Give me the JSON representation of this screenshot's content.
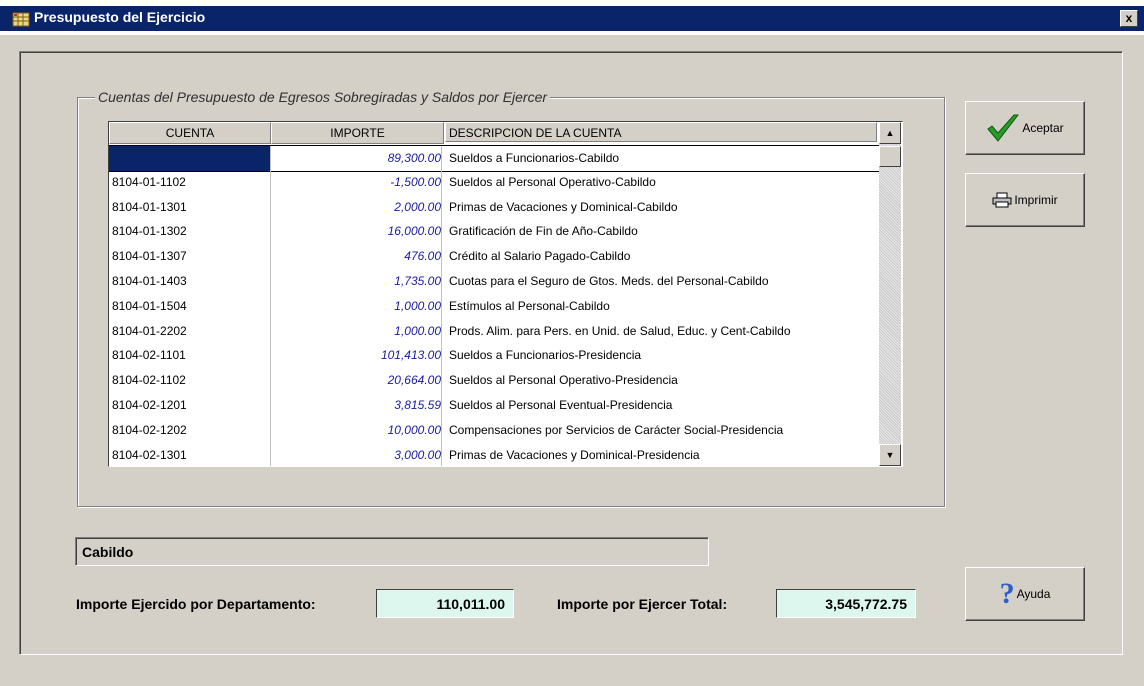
{
  "window": {
    "title": "Presupuesto del Ejercicio",
    "close_label": "x"
  },
  "group": {
    "label": "Cuentas del Presupuesto de Egresos Sobregiradas y Saldos por Ejercer"
  },
  "grid": {
    "columns": [
      "CUENTA",
      "IMPORTE",
      "DESCRIPCION DE LA CUENTA"
    ],
    "rows": [
      {
        "cuenta": "",
        "importe": "89,300.00",
        "descripcion": "Sueldos a Funcionarios-Cabildo"
      },
      {
        "cuenta": "8104-01-1102",
        "importe": "-1,500.00",
        "descripcion": "Sueldos al Personal Operativo-Cabildo"
      },
      {
        "cuenta": "8104-01-1301",
        "importe": "2,000.00",
        "descripcion": "Primas de Vacaciones y Dominical-Cabildo"
      },
      {
        "cuenta": "8104-01-1302",
        "importe": "16,000.00",
        "descripcion": "Gratificación de Fin de Año-Cabildo"
      },
      {
        "cuenta": "8104-01-1307",
        "importe": "476.00",
        "descripcion": "Crédito al Salario Pagado-Cabildo"
      },
      {
        "cuenta": "8104-01-1403",
        "importe": "1,735.00",
        "descripcion": "Cuotas para el Seguro de Gtos. Meds. del Personal-Cabildo"
      },
      {
        "cuenta": "8104-01-1504",
        "importe": "1,000.00",
        "descripcion": "Estímulos al Personal-Cabildo"
      },
      {
        "cuenta": "8104-01-2202",
        "importe": "1,000.00",
        "descripcion": "Prods. Alim. para Pers. en Unid. de Salud, Educ. y Cent-Cabildo"
      },
      {
        "cuenta": "8104-02-1101",
        "importe": "101,413.00",
        "descripcion": "Sueldos a Funcionarios-Presidencia"
      },
      {
        "cuenta": "8104-02-1102",
        "importe": "20,664.00",
        "descripcion": "Sueldos al Personal Operativo-Presidencia"
      },
      {
        "cuenta": "8104-02-1201",
        "importe": "3,815.59",
        "descripcion": "Sueldos al Personal Eventual-Presidencia"
      },
      {
        "cuenta": "8104-02-1202",
        "importe": "10,000.00",
        "descripcion": "Compensaciones por Servicios de Carácter Social-Presidencia"
      },
      {
        "cuenta": "8104-02-1301",
        "importe": "3,000.00",
        "descripcion": "Primas de Vacaciones y Dominical-Presidencia"
      }
    ]
  },
  "buttons": {
    "aceptar": "Aceptar",
    "imprimir": "Imprimir",
    "ayuda": "Ayuda"
  },
  "department": {
    "value": "Cabildo"
  },
  "totals": {
    "ejercido_label": "Importe Ejercido por Departamento:",
    "ejercido_value": "110,011.00",
    "por_ejercer_label": "Importe por Ejercer Total:",
    "por_ejercer_value": "3,545,772.75"
  },
  "colors": {
    "titlebar": "#0a246a",
    "window_bg": "#d4d0c8",
    "value_bg": "#ddf7ef",
    "importe_text": "#1a1aa0"
  },
  "icons": {
    "app": "spreadsheet-icon",
    "aceptar": "checkmark-icon",
    "imprimir": "printer-icon",
    "ayuda": "question-mark-icon"
  }
}
